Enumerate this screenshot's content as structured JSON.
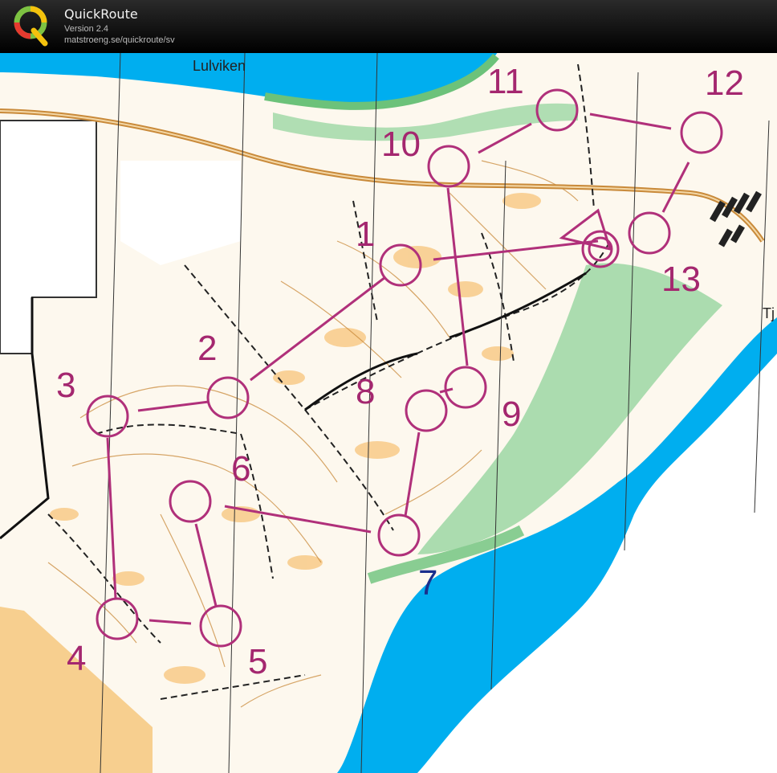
{
  "app": {
    "title": "QuickRoute",
    "version": "Version 2.4",
    "url": "matstroeng.se/quickroute/sv"
  },
  "map": {
    "place_names": [
      "Lulviken",
      "Tj"
    ],
    "controls": [
      {
        "label": "1",
        "color": "#a4276f"
      },
      {
        "label": "2",
        "color": "#a4276f"
      },
      {
        "label": "3",
        "color": "#a4276f"
      },
      {
        "label": "4",
        "color": "#a4276f"
      },
      {
        "label": "5",
        "color": "#a4276f"
      },
      {
        "label": "6",
        "color": "#a4276f"
      },
      {
        "label": "7",
        "color": "#1a2f8c"
      },
      {
        "label": "8",
        "color": "#a4276f"
      },
      {
        "label": "9",
        "color": "#a4276f"
      },
      {
        "label": "10",
        "color": "#a4276f"
      },
      {
        "label": "11",
        "color": "#a4276f"
      },
      {
        "label": "12",
        "color": "#a4276f"
      },
      {
        "label": "13",
        "color": "#a4276f"
      }
    ],
    "colors": {
      "course": "#b0307a",
      "water": "#00aeef",
      "forest_green": "#6cc27a",
      "open_land": "#f6b55f",
      "road": "#c98a3a"
    }
  }
}
